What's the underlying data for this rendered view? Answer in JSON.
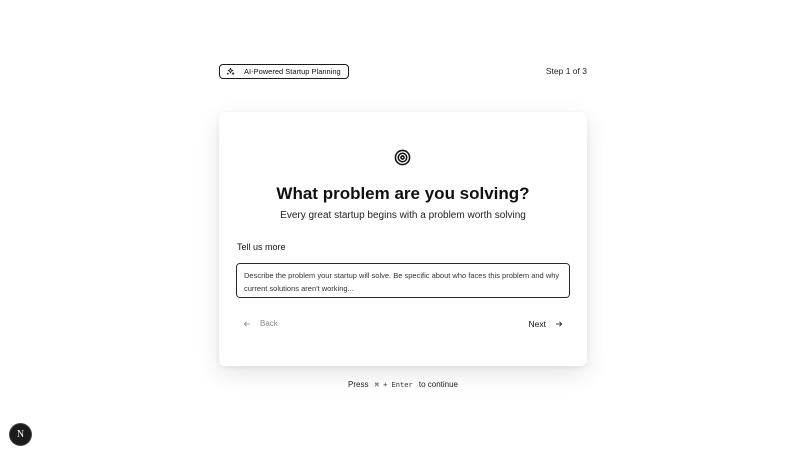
{
  "header": {
    "badge_label": "AI-Powered Startup Planning",
    "badge_icon": "sparkles-icon",
    "step": "Step 1 of 3"
  },
  "card": {
    "icon": "target-icon",
    "title": "What problem are you solving?",
    "subtitle": "Every great startup begins with a problem worth solving",
    "field_label": "Tell us more",
    "textarea_placeholder": "Describe the problem your startup will solve. Be specific about who faces this problem and why current solutions aren't working...",
    "textarea_value": "",
    "back_label": "Back",
    "next_label": "Next"
  },
  "hint": {
    "prefix": "Press",
    "keys": "⌘ + Enter",
    "suffix": "to continue"
  },
  "dev_badge": {
    "letter": "N"
  }
}
